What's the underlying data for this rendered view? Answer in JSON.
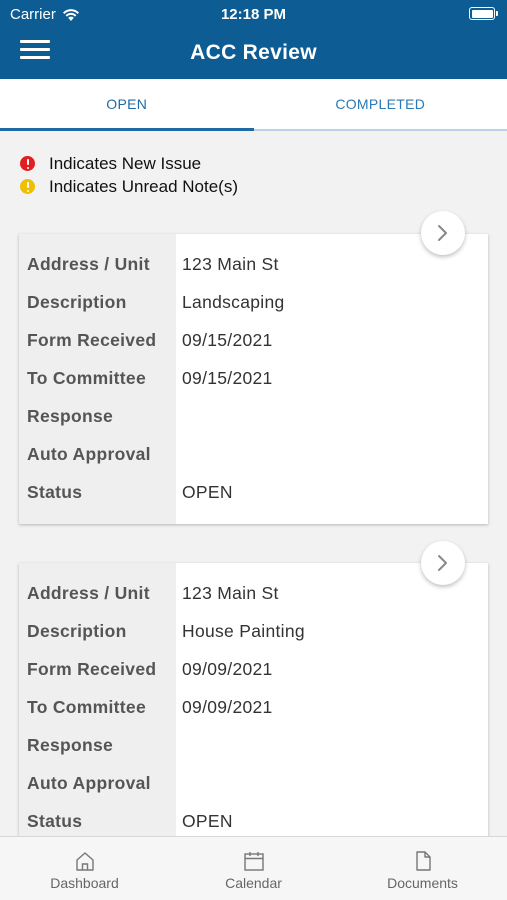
{
  "status_bar": {
    "carrier": "Carrier",
    "time": "12:18 PM"
  },
  "header": {
    "title": "ACC Review",
    "menu_icon": "hamburger-icon"
  },
  "tabs": [
    {
      "label": "OPEN",
      "active": true
    },
    {
      "label": "COMPLETED",
      "active": false
    }
  ],
  "legend": {
    "new_issue": {
      "text": "Indicates New Issue",
      "color": "#e02020"
    },
    "unread_note": {
      "text": "Indicates Unread Note(s)",
      "color": "#f0c000"
    }
  },
  "field_labels": {
    "address": "Address / Unit",
    "description": "Description",
    "form_received": "Form Received",
    "to_committee": "To Committee",
    "response": "Response",
    "auto_approval": "Auto Approval",
    "status": "Status"
  },
  "cards": [
    {
      "address": "123 Main St",
      "description": "Landscaping",
      "form_received": "09/15/2021",
      "to_committee": "09/15/2021",
      "response": "",
      "auto_approval": "",
      "status": "OPEN"
    },
    {
      "address": "123 Main St",
      "description": "House Painting",
      "form_received": "09/09/2021",
      "to_committee": "09/09/2021",
      "response": "",
      "auto_approval": "",
      "status": "OPEN"
    }
  ],
  "tabbar": [
    {
      "label": "Dashboard",
      "icon": "home-icon"
    },
    {
      "label": "Calendar",
      "icon": "calendar-icon"
    },
    {
      "label": "Documents",
      "icon": "document-icon"
    }
  ],
  "colors": {
    "header": "#0d5c93",
    "accent": "#1d6aa6"
  }
}
